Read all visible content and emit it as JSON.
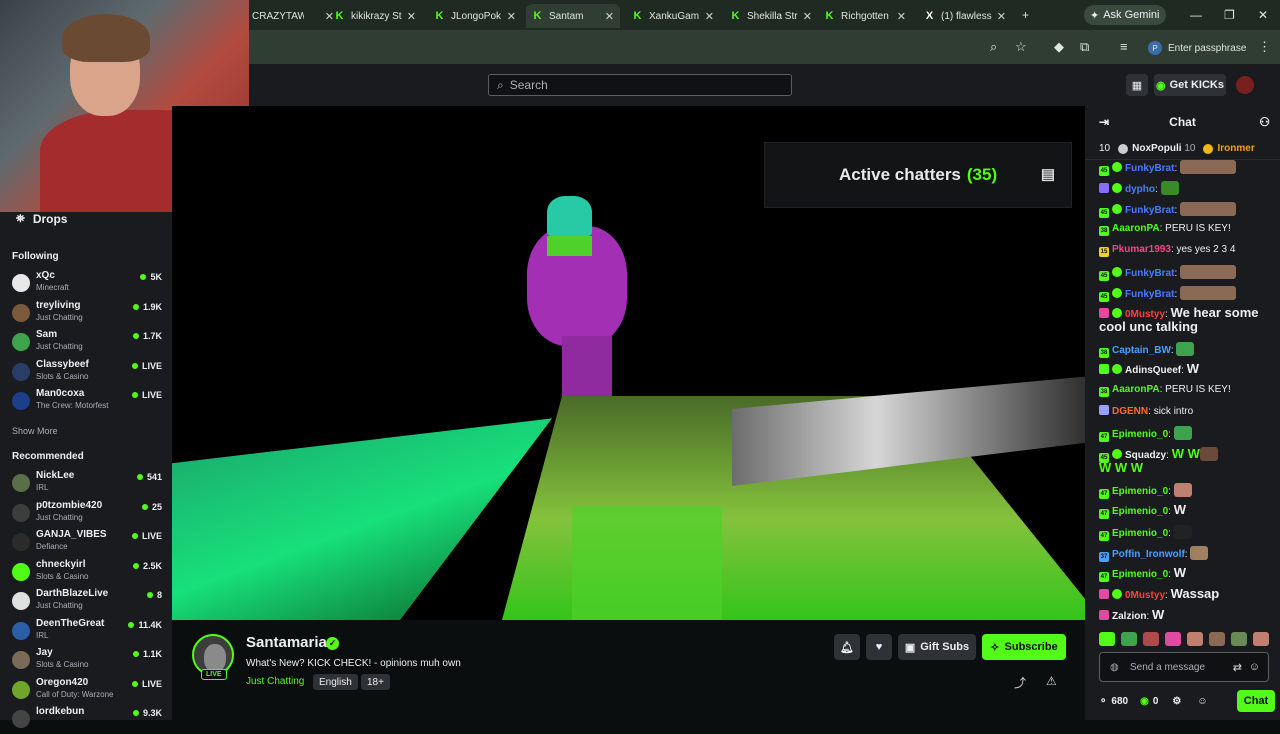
{
  "browser": {
    "tabs": [
      {
        "label": "CRAZYTAW",
        "favicon": ""
      },
      {
        "label": "kikikrazy St",
        "favicon": "K"
      },
      {
        "label": "JLongoPok",
        "favicon": "K"
      },
      {
        "label": "Santam",
        "favicon": "K",
        "active": true
      },
      {
        "label": "XankuGam",
        "favicon": "K"
      },
      {
        "label": "Shekilla Str",
        "favicon": "K"
      },
      {
        "label": "Richgotten",
        "favicon": "K"
      },
      {
        "label": "(1) flawless",
        "favicon": "X"
      }
    ],
    "ask_gemini": "Ask Gemini",
    "passphrase": "Enter passphrase"
  },
  "topnav": {
    "search_placeholder": "Search",
    "get_kicks": "Get KICKs"
  },
  "sidebar": {
    "drops_label": "Drops",
    "following_heading": "Following",
    "following": [
      {
        "name": "xQc",
        "category": "Minecraft",
        "viewers": "5K",
        "color": "#e8e8e8"
      },
      {
        "name": "treyliving",
        "category": "Just Chatting",
        "viewers": "1.9K",
        "color": "#7a5a3a"
      },
      {
        "name": "Sam",
        "category": "Just Chatting",
        "viewers": "1.7K",
        "color": "#3fa34d"
      },
      {
        "name": "Classybeef",
        "category": "Slots & Casino",
        "viewers": "LIVE",
        "color": "#2a3d66"
      },
      {
        "name": "Man0coxa",
        "category": "The Crew: Motorfest",
        "viewers": "LIVE",
        "color": "#1d3f8a"
      }
    ],
    "show_more": "Show More",
    "recommended_heading": "Recommended",
    "recommended": [
      {
        "name": "NickLee",
        "category": "IRL",
        "viewers": "541",
        "color": "#5b6e4a"
      },
      {
        "name": "p0tzombie420",
        "category": "Just Chatting",
        "viewers": "25",
        "color": "#3d3d3d"
      },
      {
        "name": "GANJA_VIBES",
        "category": "Defiance",
        "viewers": "LIVE",
        "color": "#2b2b2b"
      },
      {
        "name": "chneckyirl",
        "category": "Slots & Casino",
        "viewers": "2.5K",
        "color": "#53fc18"
      },
      {
        "name": "DarthBlazeLive",
        "category": "Just Chatting",
        "viewers": "8",
        "color": "#e0e0e0"
      },
      {
        "name": "DeenTheGreat",
        "category": "IRL",
        "viewers": "11.4K",
        "color": "#2a5fa8"
      },
      {
        "name": "Jay",
        "category": "Slots & Casino",
        "viewers": "1.1K",
        "color": "#7b6a55"
      },
      {
        "name": "Oregon420",
        "category": "Call of Duty: Warzone",
        "viewers": "LIVE",
        "color": "#6ea52a"
      },
      {
        "name": "lordkebun",
        "category": "",
        "viewers": "9.3K",
        "color": "#444"
      }
    ]
  },
  "video": {
    "active_chatters_label": "Active chatters",
    "active_chatters_count": "(35)"
  },
  "stream": {
    "streamer": "Santamaria",
    "title": "What's New? KICK CHECK! - opinions muh own",
    "category": "Just Chatting",
    "language": "English",
    "rating": "18+",
    "live_badge": "LIVE",
    "gift_subs": "Gift Subs",
    "subscribe": "Subscribe"
  },
  "chat": {
    "header": "Chat",
    "pinned_count": "10",
    "pinned_user1": "NoxPopuli",
    "pinned_user1_count": "10",
    "pinned_user2": "Ironmer",
    "messages": [
      {
        "user": "FunkyBrat",
        "text": "",
        "color": "#4a7cff",
        "badge": "45",
        "badgecolor": "#53fc18",
        "verified": true,
        "emote": "#8a6a55"
      },
      {
        "user": "dypho",
        "text": "",
        "color": "#4a7cff",
        "badge": "",
        "badgecolor": "#8a6cff",
        "verified": true,
        "emote": "#3a8a2a"
      },
      {
        "user": "FunkyBrat",
        "text": "",
        "color": "#4a7cff",
        "badge": "45",
        "badgecolor": "#53fc18",
        "verified": true,
        "emote": "#8a6a55"
      },
      {
        "user": "AaaronPA",
        "text": "PERU IS KEY!",
        "color": "#53fc18",
        "badge": "38",
        "badgecolor": "#53fc18",
        "verified": false,
        "emote": ""
      },
      {
        "user": "Pkumar1993",
        "text": "yes yes 2 3 4",
        "color": "#f04a8a",
        "badge": "15",
        "badgecolor": "#f0d31a",
        "verified": false,
        "emote": ""
      },
      {
        "user": "FunkyBrat",
        "text": "",
        "color": "#4a7cff",
        "badge": "45",
        "badgecolor": "#53fc18",
        "verified": true,
        "emote": "#8a6a55"
      },
      {
        "user": "FunkyBrat",
        "text": "",
        "color": "#4a7cff",
        "badge": "45",
        "badgecolor": "#53fc18",
        "verified": true,
        "emote": "#8a6a55"
      },
      {
        "user": "0Mustyy",
        "text": "We hear some cool unc talking",
        "color": "#ff4040",
        "badge": "",
        "badgecolor": "#e04aa0",
        "verified": true,
        "emote": ""
      },
      {
        "user": "Captain_BW",
        "text": "",
        "color": "#4aa0ff",
        "badge": "38",
        "badgecolor": "#53fc18",
        "verified": false,
        "emote": "#3fa34d"
      },
      {
        "user": "AdinsQueef",
        "text": "W",
        "color": "#efeff1",
        "badge": "",
        "badgecolor": "#53fc18",
        "verified": true,
        "emote": ""
      },
      {
        "user": "AaaronPA",
        "text": "PERU IS KEY!",
        "color": "#53fc18",
        "badge": "38",
        "badgecolor": "#53fc18",
        "verified": false,
        "emote": ""
      },
      {
        "user": "DGENN",
        "text": "sick intro",
        "color": "#ff6a2a",
        "badge": "",
        "badgecolor": "#9aa0ff",
        "verified": false,
        "emote": ""
      },
      {
        "user": "Epimenio_0",
        "text": "",
        "color": "#53fc18",
        "badge": "47",
        "badgecolor": "#53fc18",
        "verified": false,
        "emote": "#3fa34d"
      },
      {
        "user": "Squadzy",
        "text": "W W",
        "color": "#efeff1",
        "badge": "45",
        "badgecolor": "#53fc18",
        "verified": true,
        "emote": "#6a4a3a"
      },
      {
        "user": "",
        "text": "W W W",
        "color": "#53fc18",
        "badge": "",
        "badgecolor": "",
        "verified": false,
        "emote": ""
      },
      {
        "user": "Epimenio_0",
        "text": "",
        "color": "#53fc18",
        "badge": "47",
        "badgecolor": "#53fc18",
        "verified": false,
        "emote": "#c08070"
      },
      {
        "user": "Epimenio_0",
        "text": "W",
        "color": "#53fc18",
        "badge": "47",
        "badgecolor": "#53fc18",
        "verified": false,
        "emote": ""
      },
      {
        "user": "Epimenio_0",
        "text": "",
        "color": "#53fc18",
        "badge": "47",
        "badgecolor": "#53fc18",
        "verified": false,
        "emote": "#222"
      },
      {
        "user": "Poffin_Ironwolf",
        "text": "",
        "color": "#4aa0ff",
        "badge": "37",
        "badgecolor": "#4aa0ff",
        "verified": false,
        "emote": "#a08060"
      },
      {
        "user": "Epimenio_0",
        "text": "W",
        "color": "#53fc18",
        "badge": "47",
        "badgecolor": "#53fc18",
        "verified": false,
        "emote": ""
      },
      {
        "user": "0Mustyy",
        "text": "Wassap",
        "color": "#ff4040",
        "badge": "",
        "badgecolor": "#e04aa0",
        "verified": true,
        "emote": ""
      },
      {
        "user": "Zalzion",
        "text": "W",
        "color": "#efeff1",
        "badge": "",
        "badgecolor": "#e04aa0",
        "verified": false,
        "emote": ""
      }
    ],
    "input_placeholder": "Send a message",
    "points": "680",
    "kicks": "0",
    "chat_button": "Chat"
  }
}
